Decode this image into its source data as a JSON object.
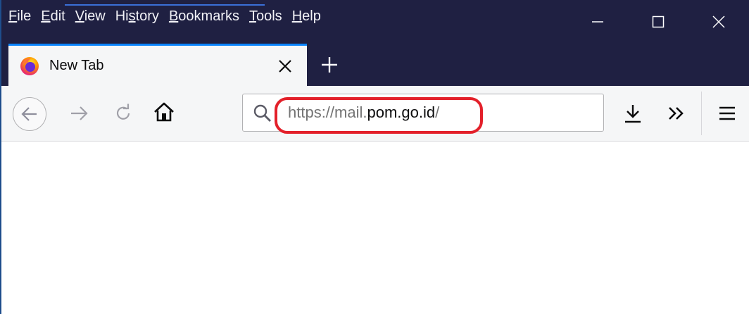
{
  "menubar": {
    "items": [
      {
        "label": "File",
        "accel": "F",
        "rest": "ile"
      },
      {
        "label": "Edit",
        "accel": "E",
        "rest": "dit"
      },
      {
        "label": "View",
        "accel": "V",
        "rest": "iew"
      },
      {
        "label": "History",
        "pre": "Hi",
        "accel": "s",
        "rest": "tory"
      },
      {
        "label": "Bookmarks",
        "accel": "B",
        "rest": "ookmarks"
      },
      {
        "label": "Tools",
        "accel": "T",
        "rest": "ools"
      },
      {
        "label": "Help",
        "accel": "H",
        "rest": "elp"
      }
    ]
  },
  "tab": {
    "title": "New Tab",
    "favicon": "firefox-logo-icon"
  },
  "urlbar": {
    "scheme_host_prefix": "https://mail.",
    "domain": "pom.go.id",
    "suffix": "/"
  },
  "colors": {
    "titlebar": "#1f2042",
    "tab_accent": "#0a84ff",
    "highlight": "#e3202a",
    "toolbar_bg": "#f5f6f7"
  }
}
